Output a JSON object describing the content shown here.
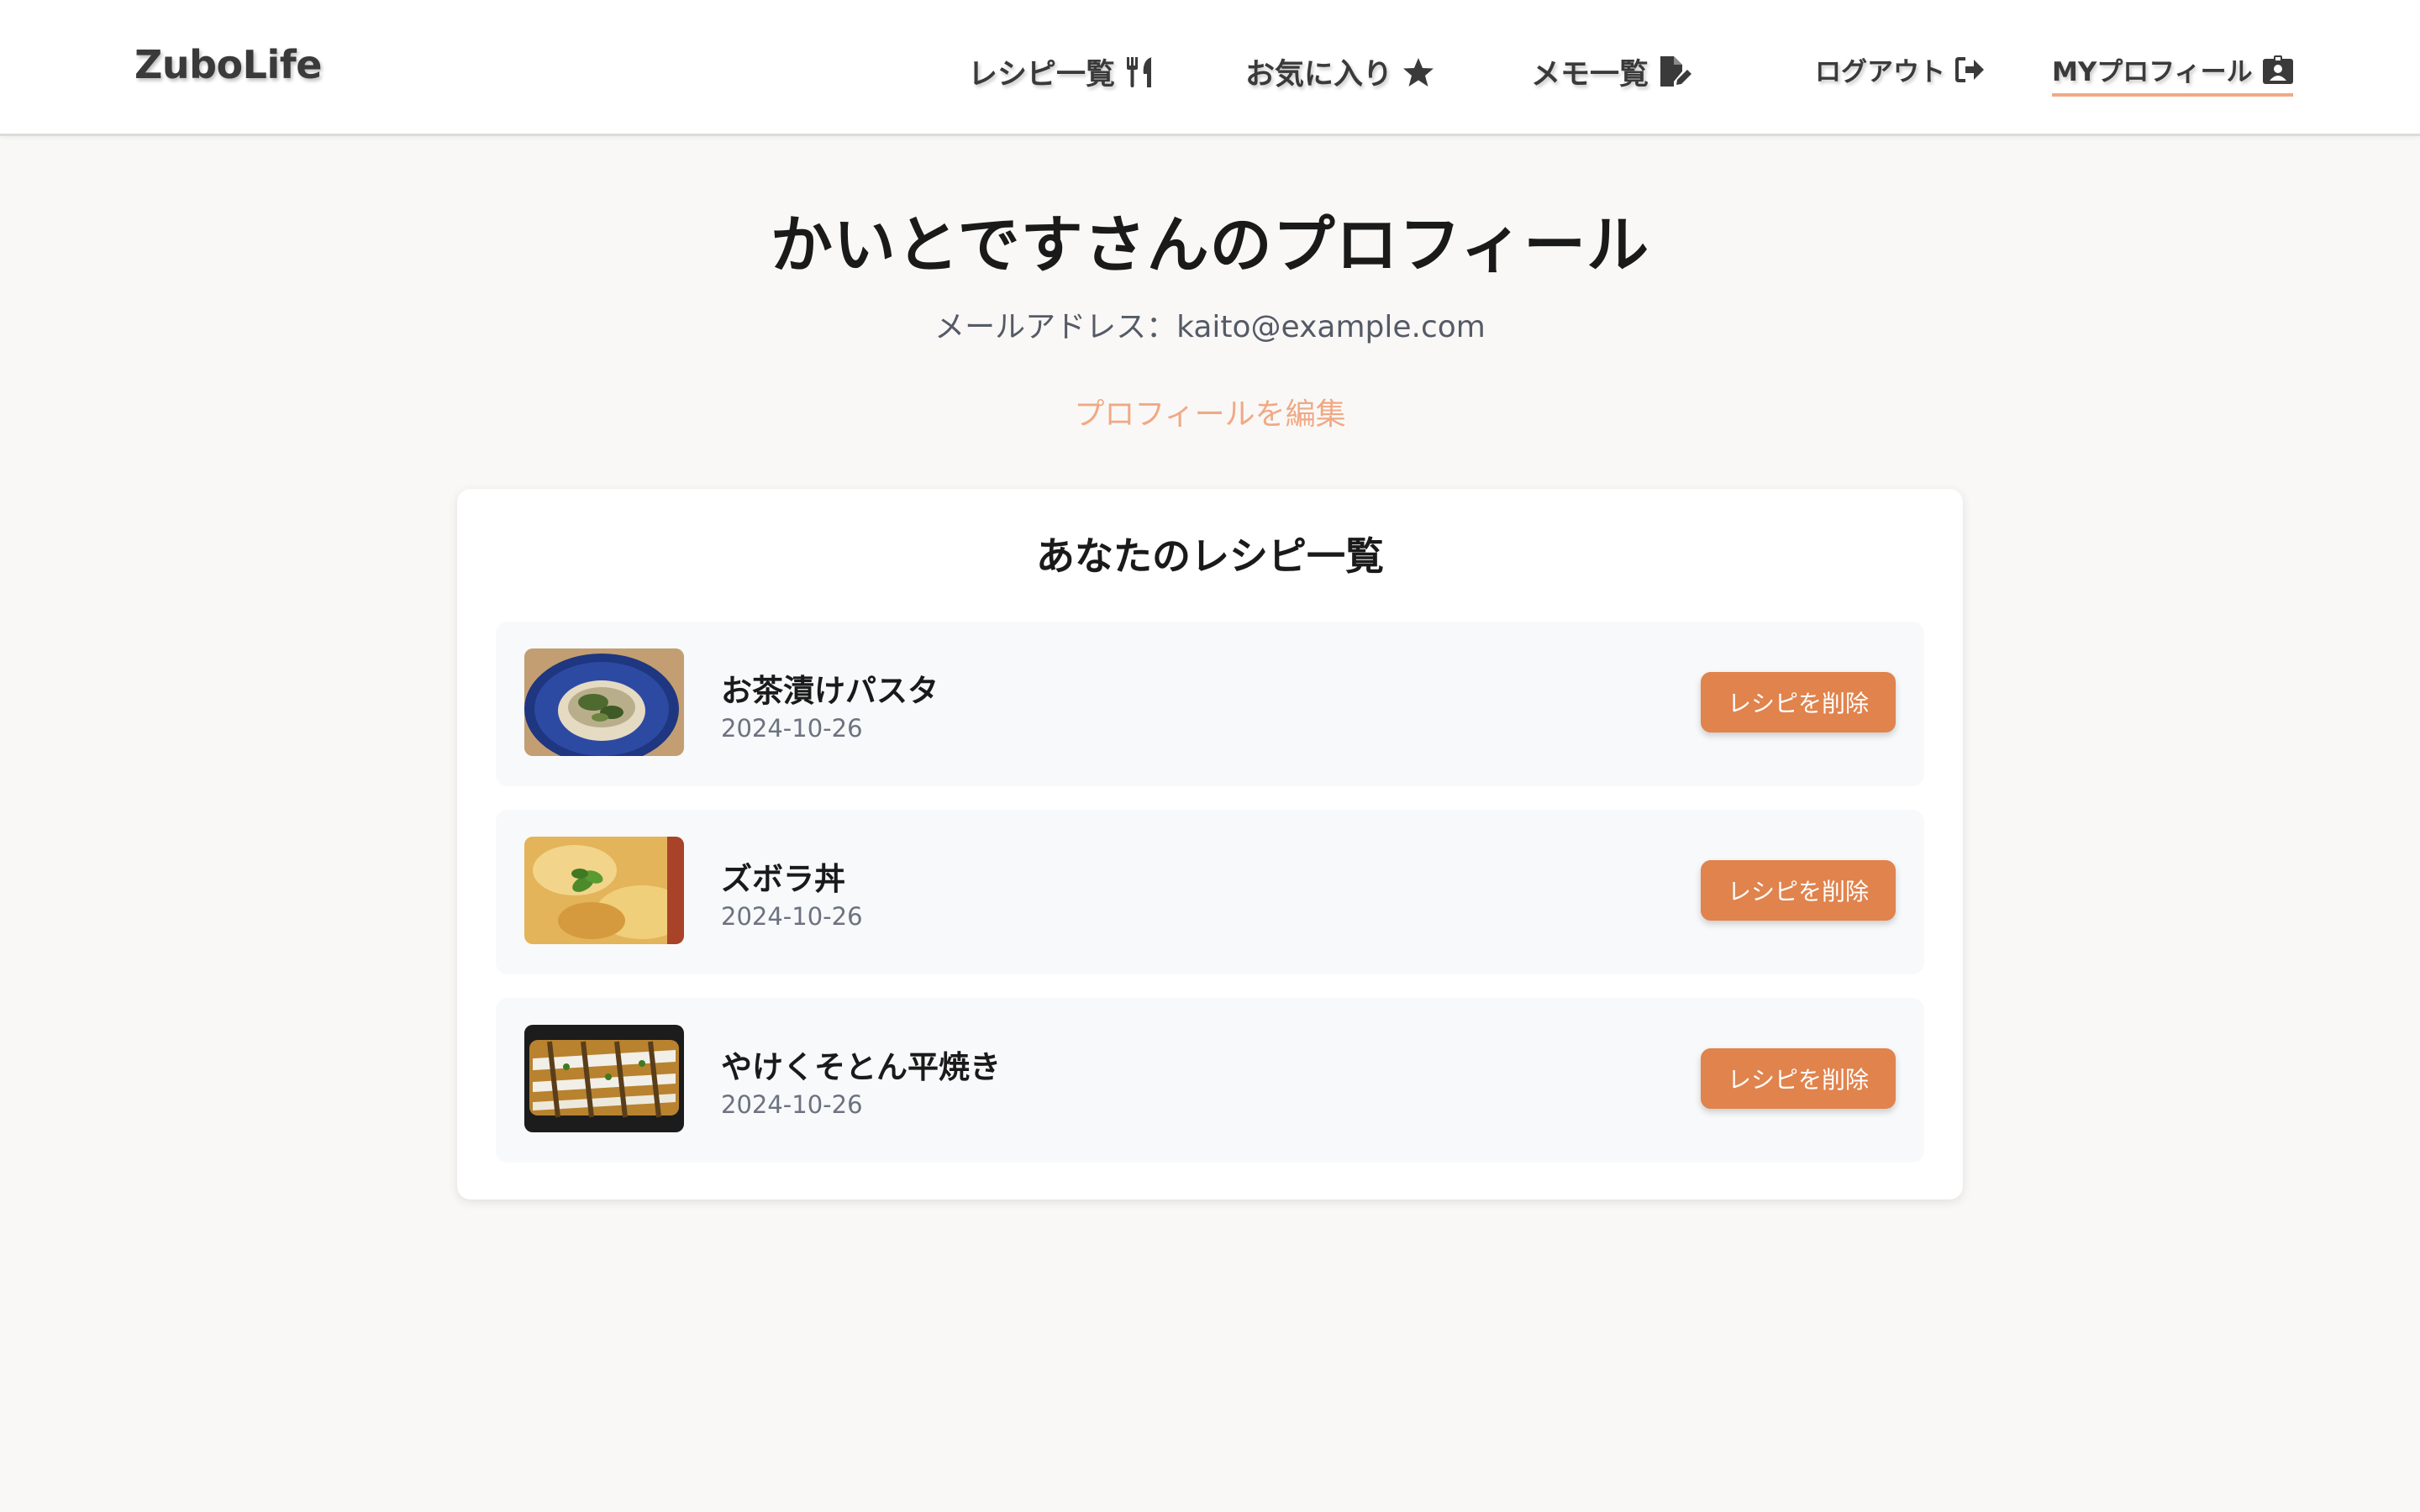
{
  "header": {
    "logo": "ZuboLife",
    "nav": {
      "recipes": "レシピ一覧",
      "favorites": "お気に入り",
      "memos": "メモ一覧",
      "logout": "ログアウト",
      "profile": "MYプロフィール"
    },
    "icons": {
      "recipes": "utensils-icon",
      "favorites": "star-icon",
      "memos": "file-pen-icon",
      "logout": "logout-icon",
      "profile": "id-badge-icon"
    }
  },
  "profile": {
    "title": "かいとですさんのプロフィール",
    "email_line": "メールアドレス：kaito@example.com",
    "edit_link": "プロフィールを編集"
  },
  "recipes_section": {
    "title": "あなたのレシピ一覧",
    "items": [
      {
        "name": "お茶漬けパスタ",
        "date": "2024-10-26",
        "delete_label": "レシピを削除"
      },
      {
        "name": "ズボラ丼",
        "date": "2024-10-26",
        "delete_label": "レシピを削除"
      },
      {
        "name": "やけくそとん平焼き",
        "date": "2024-10-26",
        "delete_label": "レシピを削除"
      }
    ]
  },
  "colors": {
    "accent": "#e0834d",
    "accent_light": "#f0a984",
    "background": "#f9f8f7"
  }
}
